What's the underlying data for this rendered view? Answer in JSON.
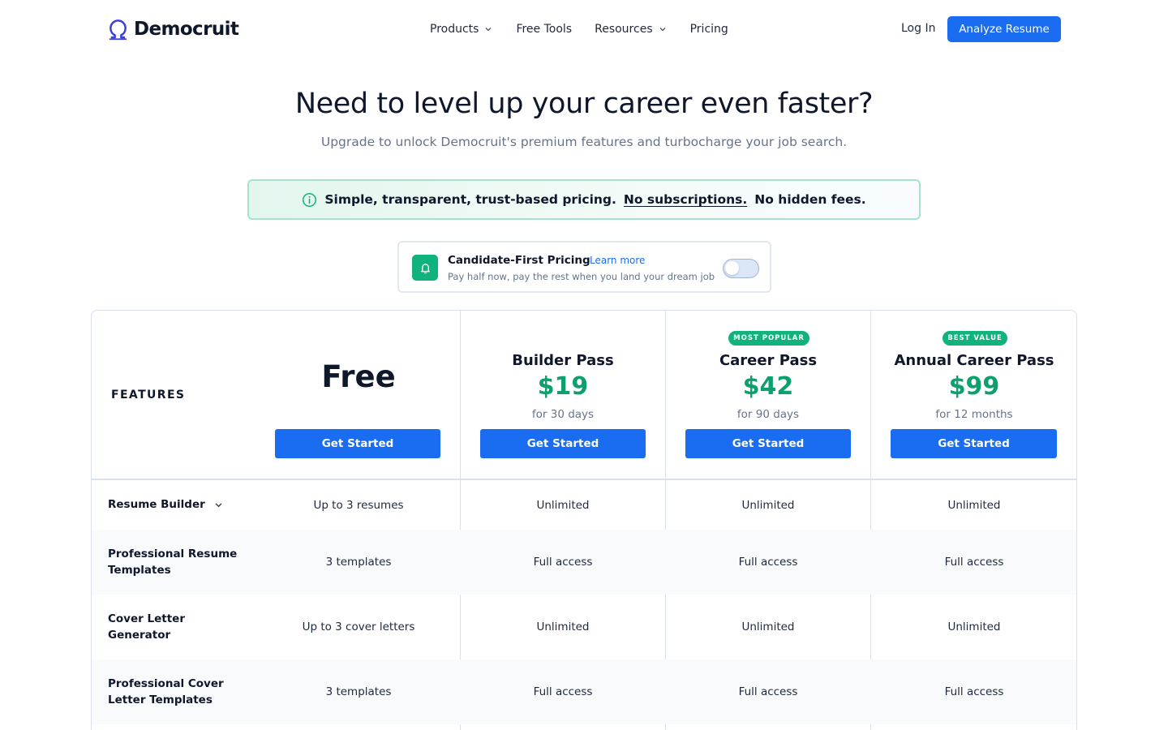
{
  "brand": {
    "name": "Democruit",
    "accent": "#1a6df0",
    "green": "#10b37d"
  },
  "nav": {
    "items": [
      {
        "label": "Products",
        "has_dropdown": true
      },
      {
        "label": "Free Tools",
        "has_dropdown": false
      },
      {
        "label": "Resources",
        "has_dropdown": true
      },
      {
        "label": "Pricing",
        "has_dropdown": false
      }
    ],
    "login": "Log In",
    "cta": "Analyze Resume"
  },
  "hero": {
    "title": "Need to level up your career even faster?",
    "subtitle": "Upgrade to unlock Democruit's premium features and turbocharge your job search."
  },
  "notice": {
    "icon": "info-icon",
    "text": "Simple, transparent, trust-based pricing.",
    "link": "No subscriptions.",
    "suffix": "No hidden fees."
  },
  "candidate_pricing": {
    "icon": "bell-icon",
    "title": "Candidate-First Pricing",
    "link": "Learn more",
    "subtitle": "Pay half now, pay the rest when you land your dream job",
    "toggle_on": false
  },
  "table": {
    "features_label": "FEATURES",
    "plans": [
      {
        "name": "Free",
        "button": "Get Started"
      },
      {
        "name": "Builder Pass",
        "price": "$19",
        "period": "for 30 days",
        "button": "Get Started"
      },
      {
        "name": "Career Pass",
        "price": "$42",
        "period": "for 90 days",
        "badge": "MOST POPULAR",
        "button": "Get Started"
      },
      {
        "name": "Annual Career Pass",
        "price": "$99",
        "period": "for 12 months",
        "badge": "BEST VALUE",
        "button": "Get Started"
      }
    ],
    "rows": [
      {
        "feature": "Resume Builder",
        "expandable": true,
        "values": [
          "Up to 3 resumes",
          "Unlimited",
          "Unlimited",
          "Unlimited"
        ]
      },
      {
        "feature": "Professional Resume Templates",
        "values": [
          "3 templates",
          "Full access",
          "Full access",
          "Full access"
        ]
      },
      {
        "feature": "Cover Letter Generator",
        "values": [
          "Up to 3 cover letters",
          "Unlimited",
          "Unlimited",
          "Unlimited"
        ]
      },
      {
        "feature": "Professional Cover Letter Templates",
        "values": [
          "3 templates",
          "Full access",
          "Full access",
          "Full access"
        ]
      }
    ]
  }
}
